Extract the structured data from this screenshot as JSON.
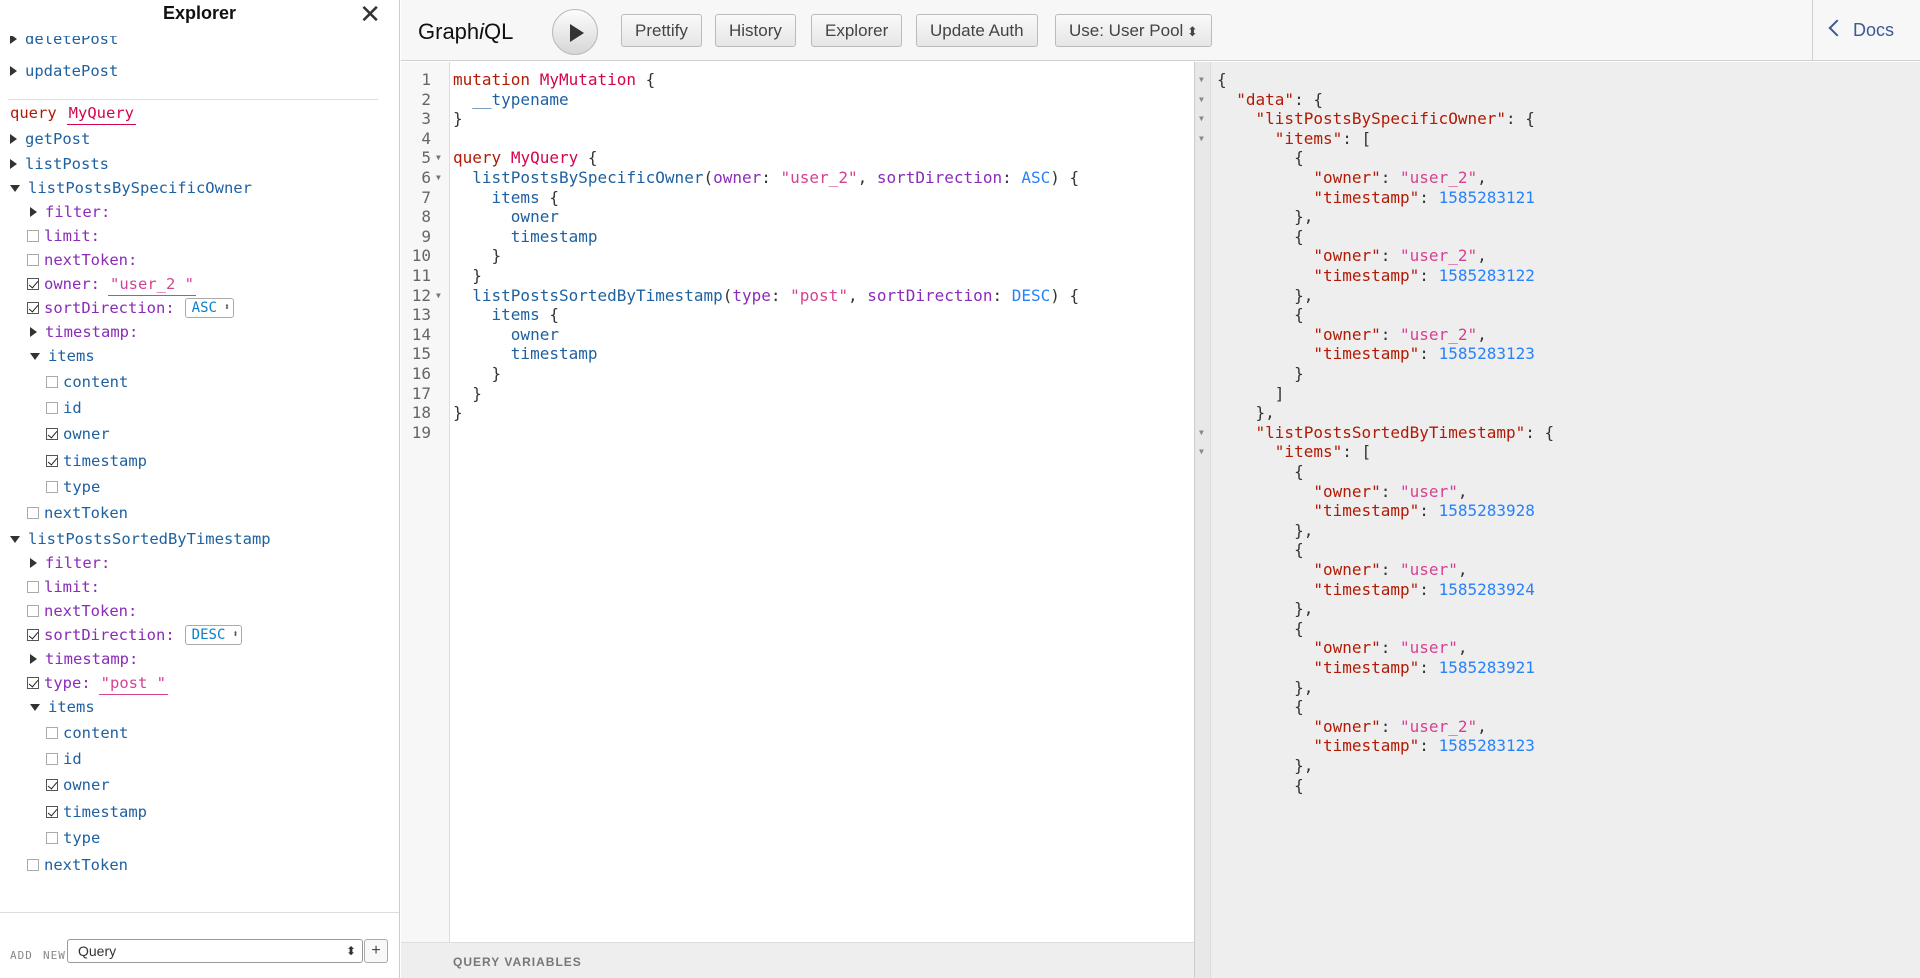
{
  "explorer": {
    "title": "Explorer",
    "close_icon": "close-icon",
    "cut_item": "deletePost",
    "update_item": "updatePost",
    "query_keyword": "query",
    "query_name": "MyQuery",
    "get_post": "getPost",
    "list_posts": "listPosts",
    "owner_field": {
      "name": "listPostsBySpecificOwner",
      "filter": "filter:",
      "limit": "limit:",
      "next_token_arg": "nextToken:",
      "owner_label": "owner:",
      "owner_value": "\"user_2 \"",
      "sort_label": "sortDirection:",
      "sort_value": "ASC",
      "timestamp_arg": "timestamp:",
      "items": "items",
      "sub": [
        "content",
        "id",
        "owner",
        "timestamp",
        "type"
      ],
      "next_token": "nextToken"
    },
    "ts_field": {
      "name": "listPostsSortedByTimestamp",
      "filter": "filter:",
      "limit": "limit:",
      "next_token_arg": "nextToken:",
      "sort_label": "sortDirection:",
      "sort_value": "DESC",
      "timestamp_arg": "timestamp:",
      "type_label": "type:",
      "type_value": "\"post \"",
      "items": "items",
      "sub": [
        "content",
        "id",
        "owner",
        "timestamp",
        "type"
      ],
      "next_token": "nextToken"
    },
    "footer": {
      "add": "ADD",
      "new": "NEW",
      "select": "Query",
      "plus": "+"
    }
  },
  "toolbar": {
    "logo_pre": "Graph",
    "logo_i": "i",
    "logo_post": "QL",
    "prettify": "Prettify",
    "history": "History",
    "explorer": "Explorer",
    "update_auth": "Update Auth",
    "use_pool": "Use: User Pool",
    "docs": "Docs"
  },
  "editor": {
    "line_numbers": [
      "1",
      "2",
      "3",
      "4",
      "5",
      "6",
      "7",
      "8",
      "9",
      "10",
      "11",
      "12",
      "13",
      "14",
      "15",
      "16",
      "17",
      "18",
      "19"
    ],
    "l1": {
      "kw": "mutation",
      "name": "MyMutation",
      "rest": " {"
    },
    "l2": "__typename",
    "l3": "}",
    "l5": {
      "kw": "query",
      "name": "MyQuery",
      "rest": " {"
    },
    "l6": {
      "field": "listPostsBySpecificOwner",
      "a1": "owner",
      "v1": "\"user_2\"",
      "a2": "sortDirection",
      "v2": "ASC"
    },
    "l7": "items",
    "l8": "owner",
    "l9": "timestamp",
    "l12": {
      "field": "listPostsSortedByTimestamp",
      "a1": "type",
      "v1": "\"post\"",
      "a2": "sortDirection",
      "v2": "DESC"
    },
    "l13": "items",
    "l14": "owner",
    "l15": "timestamp",
    "query_variables": "QUERY VARIABLES"
  },
  "result": {
    "data_key": "\"data\"",
    "owner_key": "\"listPostsBySpecificOwner\"",
    "ts_key": "\"listPostsSortedByTimestamp\"",
    "items_key": "\"items\"",
    "o_key": "\"owner\"",
    "t_key": "\"timestamp\"",
    "owner_items": [
      {
        "owner": "\"user_2\"",
        "timestamp": "1585283121"
      },
      {
        "owner": "\"user_2\"",
        "timestamp": "1585283122"
      },
      {
        "owner": "\"user_2\"",
        "timestamp": "1585283123"
      }
    ],
    "ts_items": [
      {
        "owner": "\"user\"",
        "timestamp": "1585283928"
      },
      {
        "owner": "\"user\"",
        "timestamp": "1585283924"
      },
      {
        "owner": "\"user\"",
        "timestamp": "1585283921"
      },
      {
        "owner": "\"user_2\"",
        "timestamp": "1585283123"
      }
    ]
  }
}
